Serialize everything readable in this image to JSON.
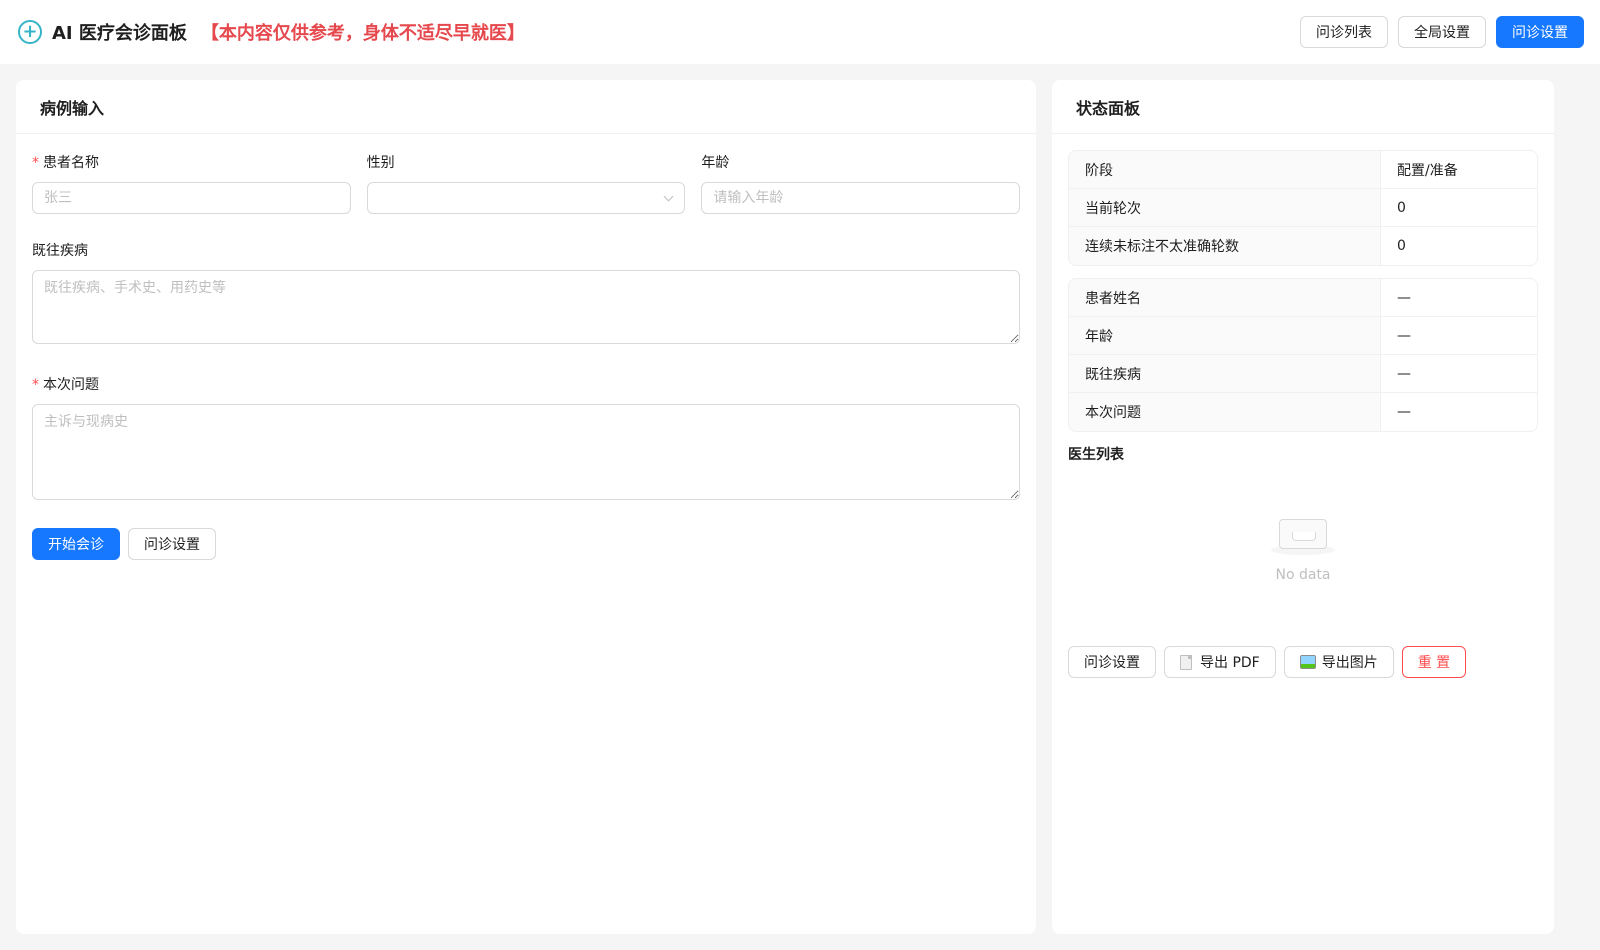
{
  "header": {
    "title": "AI 医疗会诊面板",
    "disclaimer": "【本内容仅供参考，身体不适尽早就医】",
    "buttons": {
      "consult_list": "问诊列表",
      "global_settings": "全局设置",
      "consult_settings": "问诊设置"
    }
  },
  "case_input": {
    "title": "病例输入",
    "patient_name": {
      "label": "患者名称",
      "placeholder": "张三"
    },
    "gender": {
      "label": "性别",
      "value": ""
    },
    "age": {
      "label": "年龄",
      "placeholder": "请输入年龄"
    },
    "history": {
      "label": "既往疾病",
      "placeholder": "既往疾病、手术史、用药史等"
    },
    "problem": {
      "label": "本次问题",
      "placeholder": "主诉与现病史"
    },
    "actions": {
      "start": "开始会诊",
      "settings": "问诊设置"
    }
  },
  "status_panel": {
    "title": "状态面板",
    "status_rows": [
      {
        "key": "阶段",
        "value": "配置/准备"
      },
      {
        "key": "当前轮次",
        "value": "0"
      },
      {
        "key": "连续未标注不太准确轮数",
        "value": "0"
      }
    ],
    "patient_rows": [
      {
        "key": "患者姓名",
        "value": "—"
      },
      {
        "key": "年龄",
        "value": "—"
      },
      {
        "key": "既往疾病",
        "value": "—"
      },
      {
        "key": "本次问题",
        "value": "—"
      }
    ],
    "doctor_list_title": "医生列表",
    "empty_text": "No data",
    "actions": {
      "settings": "问诊设置",
      "export_pdf": "导出 PDF",
      "export_image": "导出图片",
      "reset": "重 置"
    }
  },
  "icons": {
    "brand": "plus-circle-icon",
    "select_arrow": "chevron-down-icon",
    "empty": "empty-inbox-icon",
    "pdf": "document-icon",
    "image": "picture-icon"
  },
  "colors": {
    "primary": "#1677ff",
    "danger": "#ff4d4f",
    "disclaimer": "#e5484d",
    "brand_icon": "#36b4c8"
  }
}
